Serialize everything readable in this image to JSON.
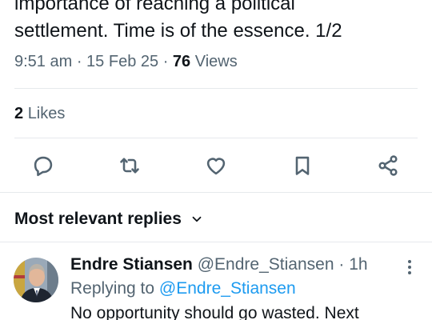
{
  "tweet": {
    "text_line1": "importance of reaching a political",
    "text_line2": "settlement. Time is of the essence. 1/2",
    "time": "9:51 am",
    "date": "15 Feb 25",
    "views_count": "76",
    "views_label": "Views",
    "likes_count": "2",
    "likes_label": "Likes"
  },
  "actions": [
    {
      "icon": "reply-icon"
    },
    {
      "icon": "retweet-icon"
    },
    {
      "icon": "like-icon"
    },
    {
      "icon": "bookmark-icon"
    },
    {
      "icon": "share-icon"
    }
  ],
  "replies": {
    "sort_label": "Most relevant replies",
    "items": [
      {
        "name": "Endre Stiansen",
        "handle": "@Endre_Stiansen",
        "age": "1h",
        "replying_prefix": "Replying to",
        "replying_to": "@Endre_Stiansen",
        "text": "No opportunity should go wasted. Next"
      }
    ]
  },
  "colors": {
    "text_primary": "#0f1419",
    "text_secondary": "#536471",
    "link": "#1d9bf0",
    "divider": "#e6e9ec"
  }
}
